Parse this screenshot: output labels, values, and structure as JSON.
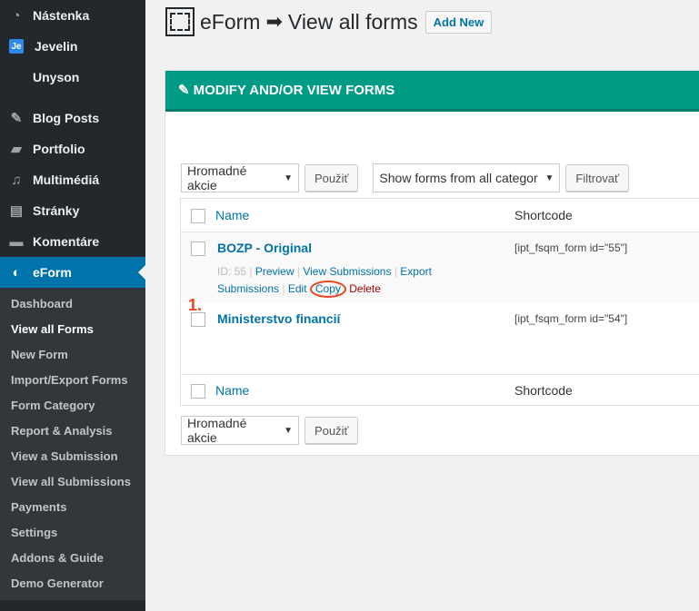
{
  "sidebar": {
    "top_items": [
      {
        "label": "Nástenka",
        "icon": "dashboard-icon"
      },
      {
        "label": "Jevelin",
        "icon": "je-icon"
      },
      {
        "label": "Unyson",
        "icon": "unyson-icon"
      }
    ],
    "main_items": [
      {
        "label": "Blog Posts",
        "icon": "pin-icon"
      },
      {
        "label": "Portfolio",
        "icon": "folder-icon"
      },
      {
        "label": "Multimédiá",
        "icon": "media-icon"
      },
      {
        "label": "Stránky",
        "icon": "pages-icon"
      },
      {
        "label": "Komentáre",
        "icon": "comment-icon"
      },
      {
        "label": "eForm",
        "icon": "eform-icon"
      }
    ],
    "submenu": [
      "Dashboard",
      "View all Forms",
      "New Form",
      "Import/Export Forms",
      "Form Category",
      "Report & Analysis",
      "View a Submission",
      "View all Submissions",
      "Payments",
      "Settings",
      "Addons & Guide",
      "Demo Generator"
    ]
  },
  "header": {
    "title_left": "eForm",
    "title_right": "View all forms",
    "add_new": "Add New"
  },
  "panel": {
    "title": "MODIFY AND/OR VIEW FORMS",
    "bulk_select": "Hromadné akcie",
    "apply": "Použiť",
    "category_select": "Show forms from all categor",
    "filter": "Filtrovať",
    "col_name": "Name",
    "col_shortcode": "Shortcode",
    "rows": [
      {
        "title": "BOZP - Original",
        "shortcode": "[ipt_fsqm_form id=\"55\"]",
        "id_label": "ID: 55",
        "actions": {
          "preview": "Preview",
          "view_submissions": "View Submissions",
          "export": "Export",
          "submissions": "Submissions",
          "edit": "Edit",
          "copy": "Copy",
          "delete": "Delete"
        }
      },
      {
        "title": "Ministerstvo financií",
        "shortcode": "[ipt_fsqm_form id=\"54\"]"
      }
    ]
  },
  "annotation": "1.",
  "colors": {
    "sidebar_bg": "#23282d",
    "active_bg": "#0073aa",
    "panel_header": "#009b85",
    "link": "#0073aa",
    "delete": "#aa0000",
    "annotation": "#e8451e"
  }
}
